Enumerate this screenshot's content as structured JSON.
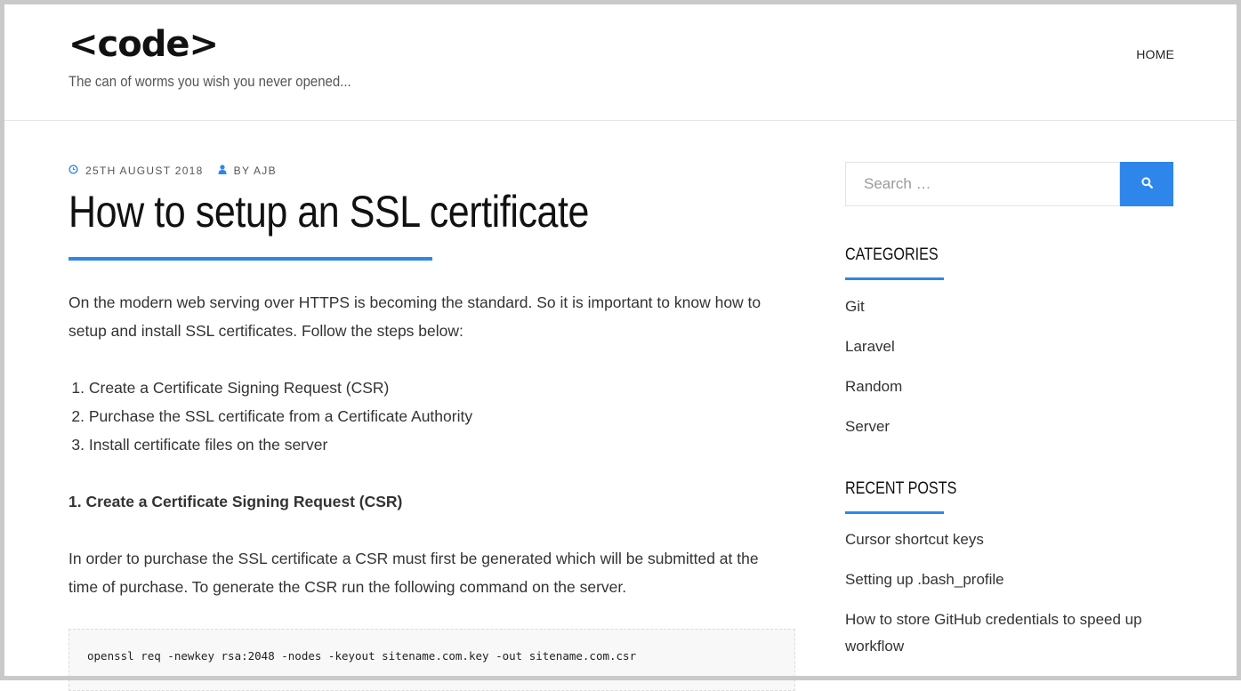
{
  "header": {
    "site_title": "<code>",
    "tagline": "The can of worms you wish you never opened...",
    "nav": [
      {
        "label": "HOME"
      }
    ]
  },
  "post": {
    "date": "25TH AUGUST 2018",
    "author": "BY AJB",
    "title": "How to setup an SSL certificate",
    "intro": "On the modern web serving over HTTPS is becoming the standard. So it is important to know how to setup and install SSL certificates. Follow the steps below:",
    "steps": [
      {
        "num": "1.",
        "text": "Create a Certificate Signing Request (CSR)"
      },
      {
        "num": "2.",
        "text": "Purchase the SSL certificate from a Certificate Authority"
      },
      {
        "num": "3.",
        "text": "Install certificate files on the server"
      }
    ],
    "section_heading": "1. Create a Certificate Signing Request (CSR)",
    "section_para": "In order to purchase the SSL certificate a CSR must first be generated which will be submitted at the time of purchase. To generate the CSR run the following command on the server.",
    "code": "openssl req -newkey rsa:2048 -nodes -keyout sitename.com.key -out sitename.com.csr"
  },
  "sidebar": {
    "search": {
      "placeholder": "Search …"
    },
    "categories": {
      "title": "CATEGORIES",
      "items": [
        "Git",
        "Laravel",
        "Random",
        "Server"
      ]
    },
    "recent_posts": {
      "title": "RECENT POSTS",
      "items": [
        "Cursor shortcut keys",
        "Setting up .bash_profile",
        "How to store GitHub credentials to speed up workflow"
      ]
    }
  },
  "colors": {
    "accent": "#2f86ea"
  },
  "icons": {
    "date": "clock-icon",
    "author": "user-icon",
    "search": "search-icon"
  }
}
